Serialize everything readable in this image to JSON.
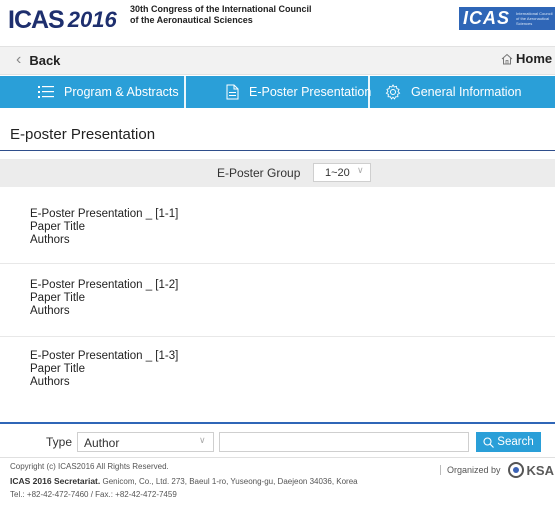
{
  "header": {
    "logo_text": "ICAS",
    "logo_year": "2016",
    "congress_line1": "30th Congress of the International Council",
    "congress_line2": "of the Aeronautical Sciences",
    "badge_text": "ICAS",
    "badge_sub": "International Council of the Aeronautical Sciences"
  },
  "backbar": {
    "back_label": "Back",
    "home_label": "Home"
  },
  "nav": {
    "items": [
      {
        "label": "Program & Abstracts",
        "icon": "list-icon"
      },
      {
        "label": "E-Poster Presentation",
        "icon": "document-icon"
      },
      {
        "label": "General Information",
        "icon": "gear-icon"
      }
    ],
    "accent": "#2a9fd8"
  },
  "page": {
    "title": "E-poster Presentation"
  },
  "group": {
    "label": "E-Poster Group",
    "selected": "1~20"
  },
  "items": [
    {
      "title": "E-Poster Presentation _ [1-1]",
      "paper": "Paper Title",
      "authors": "Authors"
    },
    {
      "title": "E-Poster Presentation _ [1-2]",
      "paper": "Paper Title",
      "authors": "Authors"
    },
    {
      "title": "E-Poster Presentation _ [1-3]",
      "paper": "Paper Title",
      "authors": "Authors"
    }
  ],
  "search": {
    "type_label": "Type",
    "type_selected": "Author",
    "input_value": "",
    "button_label": "Search"
  },
  "footer": {
    "copyright": "Copyright (c) ICAS2016 All Rights Reserved.",
    "secretariat_label": "ICAS 2016 Secretariat.",
    "secretariat_address": "Genicom, Co., Ltd. 273, Baeul 1-ro, Yuseong-gu, Daejeon 34036, Korea",
    "contact": "Tel.: +82-42-472-7460 / Fax.: +82-42-472-7459",
    "organized_by": "Organized by",
    "org_name": "KSA"
  }
}
